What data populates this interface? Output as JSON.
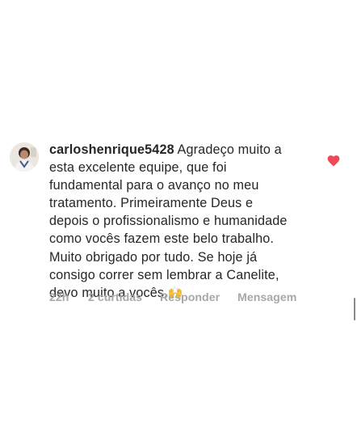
{
  "comment": {
    "username": "carloshenrique5428",
    "text": "Agradeço muito a\nesta excelente equipe, que foi\nfundamental para o avanço no meu\ntratamento. Primeiramente Deus e\ndepois o profissionalismo e humanidade\ncomo vocês fazem este belo trabalho.\nMuito obrigado por tudo. Se hoje já\nconsigo correr sem lembrar a Canelite,\ndevo muito a vocês.",
    "emoji": "🙌",
    "liked": true,
    "like_color": "#ed4956"
  },
  "meta": {
    "time": "22h",
    "likes": "2 curtidas",
    "reply_label": "Responder",
    "message_label": "Mensagem"
  },
  "icons": {
    "like": "heart-icon",
    "avatar": "profile-photo"
  }
}
